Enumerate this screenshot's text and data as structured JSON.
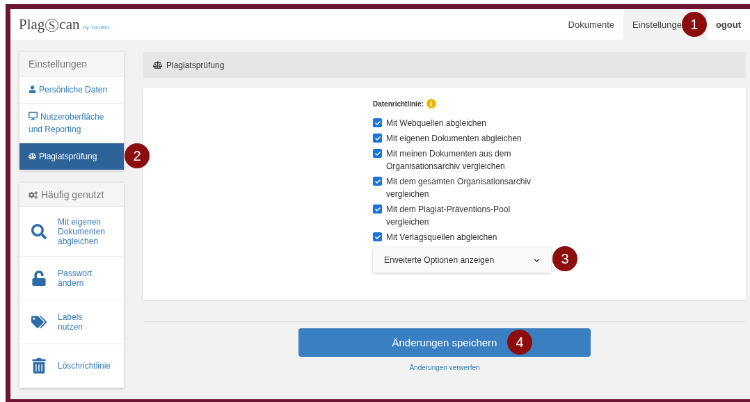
{
  "logo": {
    "name": "Plag",
    "name_end": "can",
    "letter": "S",
    "byline": "by Turnitin"
  },
  "nav": [
    {
      "label": "Dokumente",
      "selected": false,
      "bold": false
    },
    {
      "label": "Einstellunge",
      "selected": true,
      "bold": false
    },
    {
      "label": "ogout",
      "selected": false,
      "bold": true
    }
  ],
  "sidebar": {
    "title": "Einstellungen",
    "items": [
      {
        "label": "Persönliche Daten",
        "selected": false
      },
      {
        "label": "Nutzeroberfläche und Reporting",
        "selected": false
      },
      {
        "label": "Plagiatsprüfung",
        "selected": true
      }
    ]
  },
  "frequent": {
    "title": "Häufig genutzt",
    "items": [
      {
        "label": "Mit eigenen Dokumenten abgleichen"
      },
      {
        "label": "Passwort ändern"
      },
      {
        "label": "Labels nutzen"
      },
      {
        "label": "Löschrichtlinie"
      }
    ]
  },
  "panel": {
    "title": "Plagiatsprüfung",
    "policy_label": "Datenrichtlinie:",
    "options": [
      {
        "label": "Mit Webquellen abgleichen",
        "checked": true
      },
      {
        "label": "Mit eigenen Dokumenten abgleichen",
        "checked": true
      },
      {
        "label": "Mit meinen Dokumenten aus dem Organisationsarchiv vergleichen",
        "checked": true
      },
      {
        "label": "Mit dem gesamten Organisationsarchiv vergleichen",
        "checked": true
      },
      {
        "label": "Mit dem Plagiat-Präventions-Pool vergleichen",
        "checked": true
      },
      {
        "label": "Mit Verlagsquellen abgleichen",
        "checked": true
      }
    ],
    "advanced": {
      "label": "Erweiterte Optionen anzeigen",
      "expanded": false
    }
  },
  "save_button": "Änderungen speichern",
  "discard_link": "Änderungen verwerfen",
  "callouts": [
    "1",
    "2",
    "3",
    "4"
  ]
}
